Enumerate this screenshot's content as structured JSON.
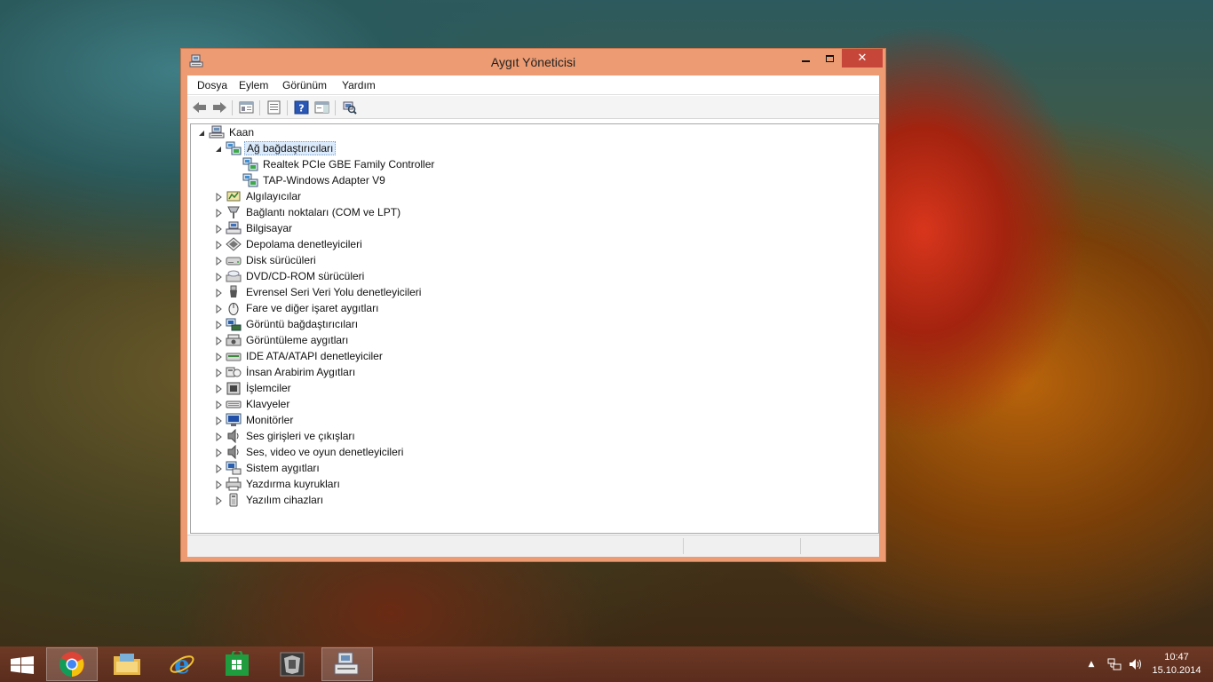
{
  "window": {
    "title": "Aygıt Yöneticisi",
    "close_glyph": "✕",
    "active_color": "#ec9b72",
    "close_color": "#c7463a"
  },
  "menu": [
    {
      "label": "Dosya"
    },
    {
      "label": "Eylem"
    },
    {
      "label": "Görünüm"
    },
    {
      "label": "Yardım"
    }
  ],
  "toolbar": [
    {
      "icon": "back-arrow-icon"
    },
    {
      "icon": "forward-arrow-icon"
    },
    {
      "icon": "show-hide-console-tree-icon"
    },
    {
      "icon": "properties-icon"
    },
    {
      "icon": "help-icon"
    },
    {
      "icon": "show-action-pane-icon"
    },
    {
      "icon": "scan-hardware-icon"
    }
  ],
  "tree": {
    "root": {
      "label": "Kaan",
      "icon": "computer-icon",
      "expanded": true
    },
    "expanded_category": {
      "label": "Ağ bağdaştırıcıları",
      "icon": "network-adapter-icon",
      "selected": true,
      "children": [
        {
          "label": "Realtek PCIe GBE Family Controller",
          "icon": "network-adapter-icon"
        },
        {
          "label": "TAP-Windows Adapter V9",
          "icon": "network-adapter-icon"
        }
      ]
    },
    "categories": [
      {
        "label": "Algılayıcılar",
        "icon": "sensor-icon"
      },
      {
        "label": "Bağlantı noktaları (COM ve LPT)",
        "icon": "port-icon"
      },
      {
        "label": "Bilgisayar",
        "icon": "computer-icon"
      },
      {
        "label": "Depolama denetleyicileri",
        "icon": "storage-controller-icon"
      },
      {
        "label": "Disk sürücüleri",
        "icon": "disk-drive-icon"
      },
      {
        "label": "DVD/CD-ROM sürücüleri",
        "icon": "dvd-drive-icon"
      },
      {
        "label": "Evrensel Seri Veri Yolu denetleyicileri",
        "icon": "usb-icon"
      },
      {
        "label": "Fare ve diğer işaret aygıtları",
        "icon": "mouse-icon"
      },
      {
        "label": "Görüntü bağdaştırıcıları",
        "icon": "display-adapter-icon"
      },
      {
        "label": "Görüntüleme aygıtları",
        "icon": "imaging-device-icon"
      },
      {
        "label": "IDE ATA/ATAPI denetleyiciler",
        "icon": "ide-controller-icon"
      },
      {
        "label": "İnsan Arabirim Aygıtları",
        "icon": "hid-icon"
      },
      {
        "label": "İşlemciler",
        "icon": "processor-icon"
      },
      {
        "label": "Klavyeler",
        "icon": "keyboard-icon"
      },
      {
        "label": "Monitörler",
        "icon": "monitor-icon"
      },
      {
        "label": "Ses girişleri ve çıkışları",
        "icon": "speaker-icon"
      },
      {
        "label": "Ses, video ve oyun denetleyicileri",
        "icon": "speaker-icon"
      },
      {
        "label": "Sistem aygıtları",
        "icon": "system-device-icon"
      },
      {
        "label": "Yazdırma kuyrukları",
        "icon": "printer-icon"
      },
      {
        "label": "Yazılım cihazları",
        "icon": "software-device-icon"
      }
    ]
  },
  "taskbar": {
    "pinned": [
      {
        "name": "chrome",
        "icon": "chrome-icon",
        "active": true
      },
      {
        "name": "file-explorer",
        "icon": "folder-icon",
        "active": false
      },
      {
        "name": "internet-explorer",
        "icon": "ie-icon",
        "active": false
      },
      {
        "name": "store",
        "icon": "store-icon",
        "active": false
      },
      {
        "name": "app",
        "icon": "app-icon",
        "active": false
      },
      {
        "name": "device-manager",
        "icon": "device-manager-icon",
        "active": true
      }
    ],
    "tray": {
      "show_hidden_glyph": "▲",
      "time": "10:47",
      "date": "15.10.2014"
    }
  }
}
